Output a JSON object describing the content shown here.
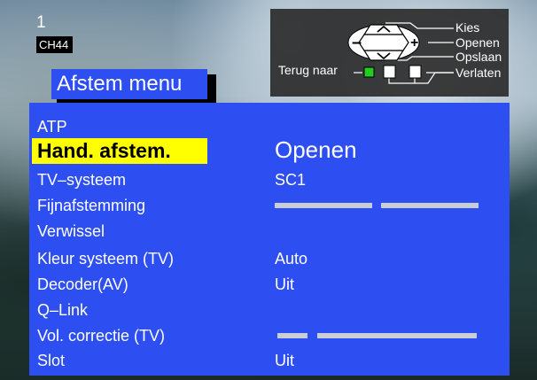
{
  "channel": {
    "number": "1",
    "name": "CH44"
  },
  "help_panel": {
    "kies": "Kies",
    "openen": "Openen",
    "opslaan": "Opslaan",
    "verlaten": "Verlaten",
    "terug_naar": "Terug naar",
    "minus_key": "–",
    "plus_key": "+",
    "accent_green": "#22cc22"
  },
  "menu": {
    "title": "Afstem menu",
    "items": [
      {
        "label": "ATP",
        "value": ""
      },
      {
        "label": "Hand. afstem.",
        "value": "Openen",
        "selected": true
      },
      {
        "label": "TV–systeem",
        "value": "SC1"
      },
      {
        "label": "Fijnafstemming",
        "value": ""
      },
      {
        "label": "Verwissel",
        "value": ""
      },
      {
        "label": "Kleur systeem (TV)",
        "value": "Auto"
      },
      {
        "label": "Decoder(AV)",
        "value": "Uit"
      },
      {
        "label": "Q–Link",
        "value": ""
      },
      {
        "label": "Vol. correctie (TV)",
        "value": ""
      },
      {
        "label": "Slot",
        "value": "Uit"
      }
    ]
  },
  "colors": {
    "menu_blue": "#2d4ef0",
    "highlight": "#ffff00"
  }
}
